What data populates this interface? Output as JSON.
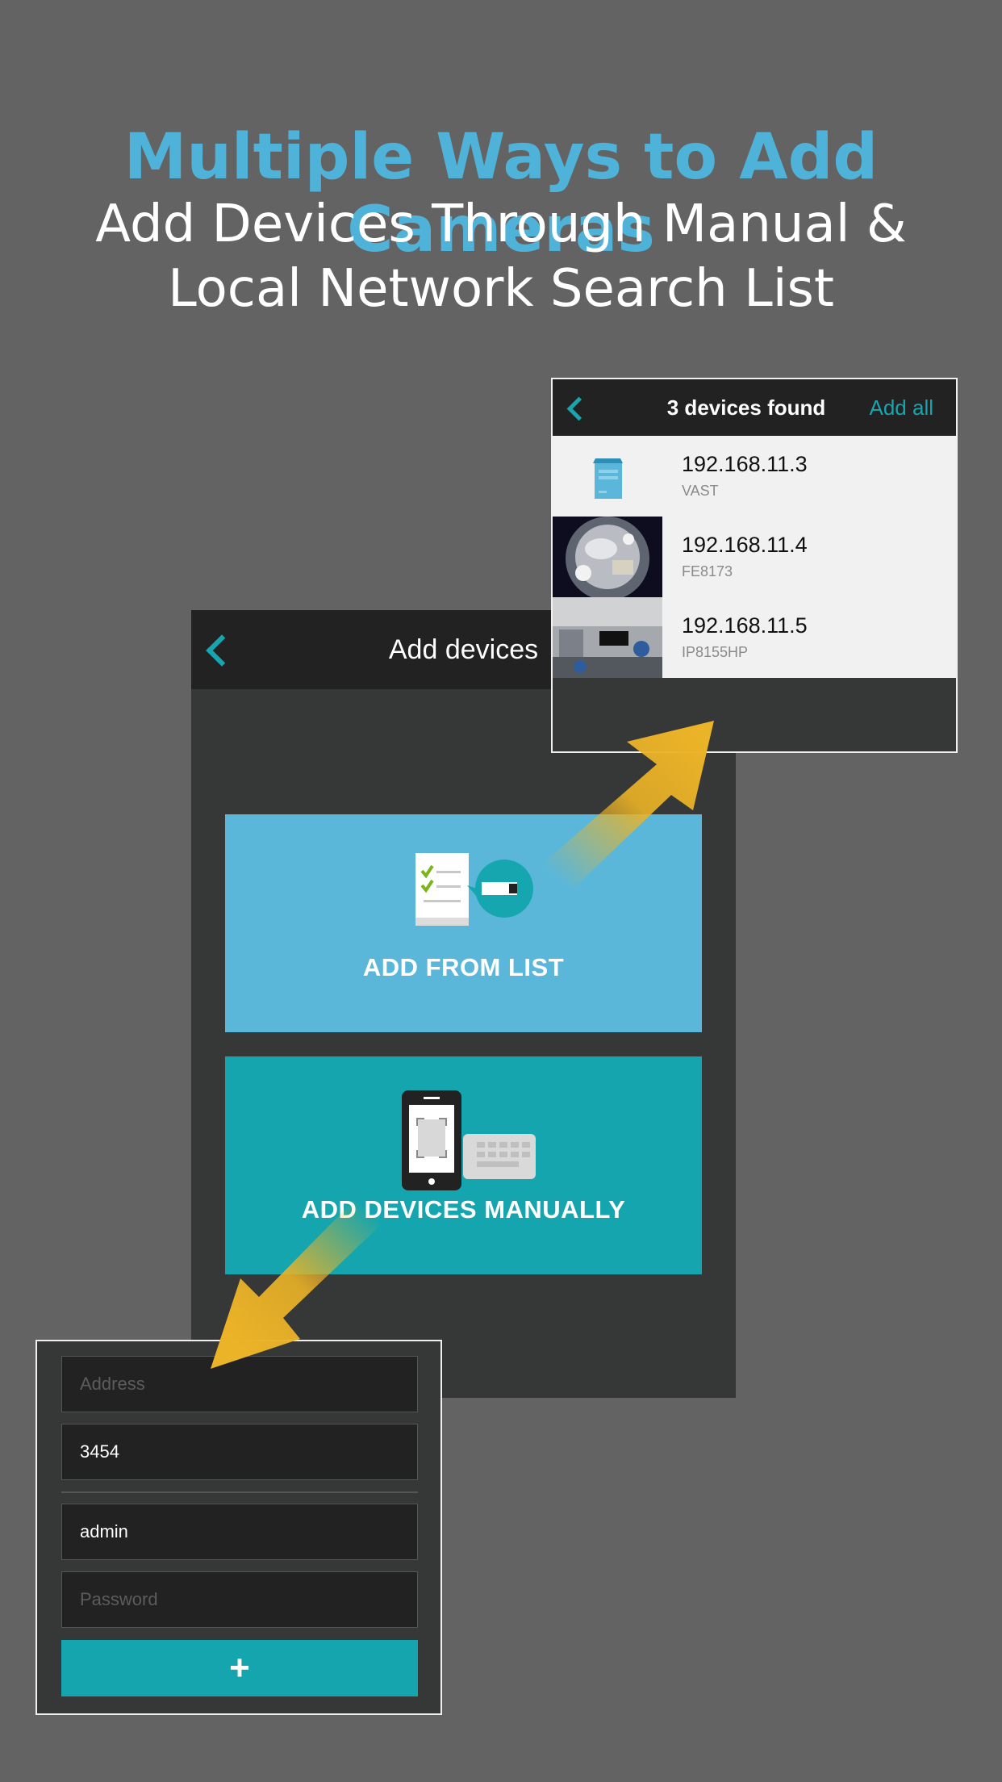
{
  "promo": {
    "headline": "Multiple Ways to Add Cameras",
    "subline_1": "Add Devices Through Manual &",
    "subline_2": "Local Network Search List"
  },
  "add_devices_screen": {
    "title": "Add devices",
    "add_from_list_label": "ADD FROM LIST",
    "add_manually_label": "ADD DEVICES MANUALLY"
  },
  "device_list": {
    "title": "3 devices found",
    "add_all_label": "Add all",
    "devices": [
      {
        "ip": "192.168.11.3",
        "model": "VAST"
      },
      {
        "ip": "192.168.11.4",
        "model": "FE8173"
      },
      {
        "ip": "192.168.11.5",
        "model": "IP8155HP"
      }
    ]
  },
  "manual_form": {
    "address_placeholder": "Address",
    "port_value": "3454",
    "username_value": "admin",
    "password_placeholder": "Password",
    "submit_label": "+"
  },
  "colors": {
    "background": "#636363",
    "headline": "#4fb3d9",
    "accent_teal": "#14a5af",
    "tile_blue": "#5ab7da",
    "arrow_yellow": "#ebb327"
  },
  "icons": {
    "back": "chevron-left-icon",
    "list": "checklist-camera-icon",
    "manual": "phone-keyboard-icon",
    "server": "nvr-server-icon",
    "add": "plus-icon"
  }
}
